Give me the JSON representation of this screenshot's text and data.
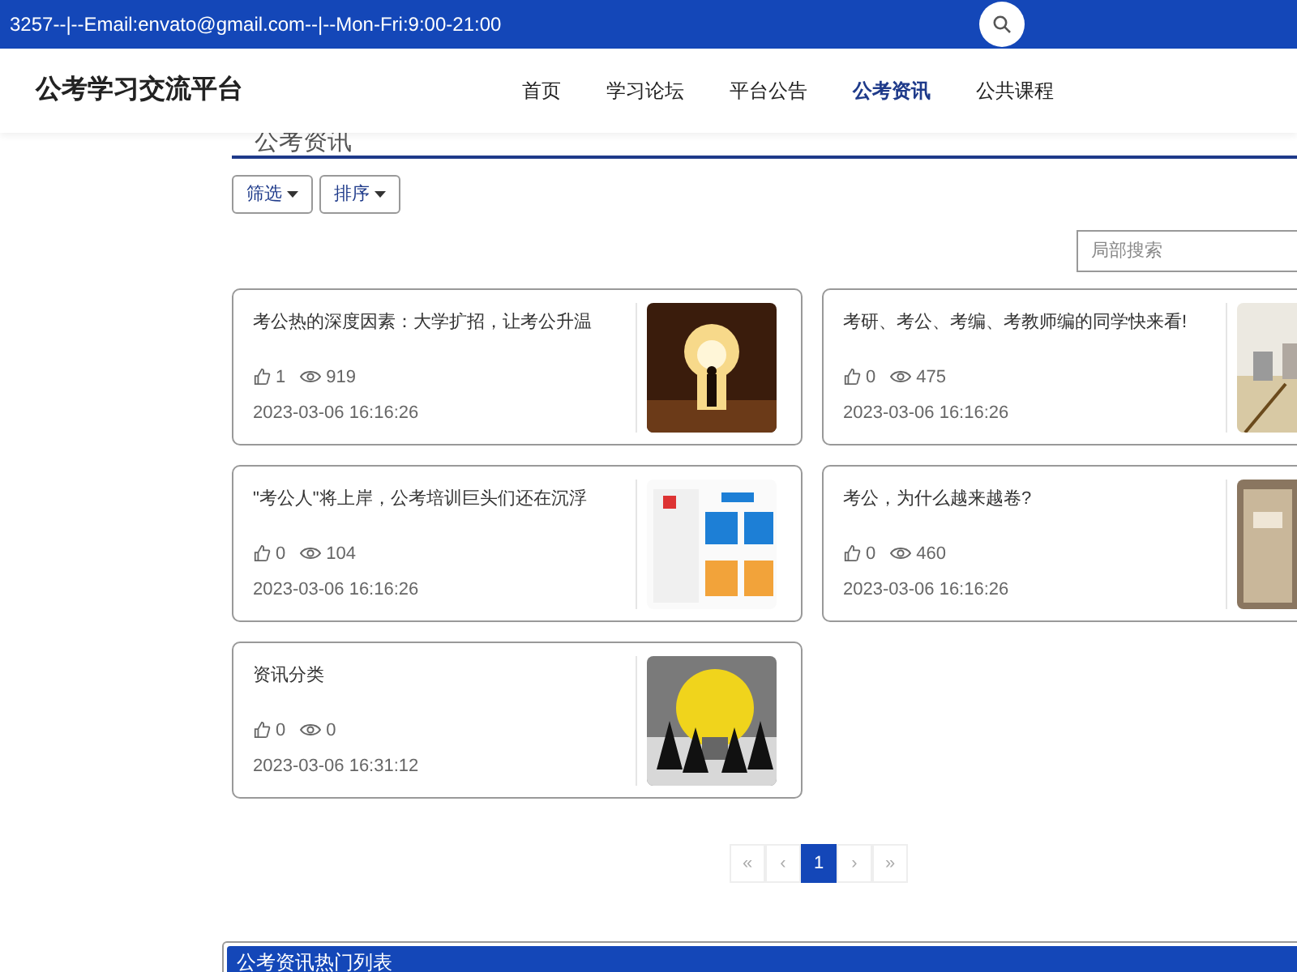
{
  "top_bar": {
    "contact": "3257--|--Email:envato@gmail.com--|--Mon-Fri:9:00-21:00"
  },
  "header": {
    "site_title": "公考学习交流平台",
    "nav": [
      {
        "label": "首页",
        "selected": false
      },
      {
        "label": "学习论坛",
        "selected": false
      },
      {
        "label": "平台公告",
        "selected": false
      },
      {
        "label": "公考资讯",
        "selected": true
      },
      {
        "label": "公共课程",
        "selected": false
      }
    ]
  },
  "section": {
    "title": "公考资讯",
    "dropdowns": [
      "筛选",
      "排序"
    ],
    "search": {
      "placeholder": "局部搜索"
    }
  },
  "articles": [
    {
      "title": "考公热的深度因素：大学扩招，让考公升温",
      "likes": "1",
      "views": "919",
      "date": "2023-03-06 16:16:26"
    },
    {
      "title": "考研、考公、考编、考教师编的同学快来看!",
      "likes": "0",
      "views": "475",
      "date": "2023-03-06 16:16:26"
    },
    {
      "title": "\"考公人\"将上岸，公考培训巨头们还在沉浮",
      "likes": "0",
      "views": "104",
      "date": "2023-03-06 16:16:26"
    },
    {
      "title": "考公，为什么越来越卷?",
      "likes": "0",
      "views": "460",
      "date": "2023-03-06 16:16:26"
    },
    {
      "title": "资讯分类",
      "likes": "0",
      "views": "0",
      "date": "2023-03-06 16:31:12"
    }
  ],
  "pagination": [
    {
      "label": "«",
      "selected": false
    },
    {
      "label": "‹",
      "selected": false
    },
    {
      "label": "1",
      "selected": true
    },
    {
      "label": "›",
      "selected": false
    },
    {
      "label": "»",
      "selected": false
    }
  ],
  "hot_list": {
    "title": "公考资讯热门列表"
  }
}
